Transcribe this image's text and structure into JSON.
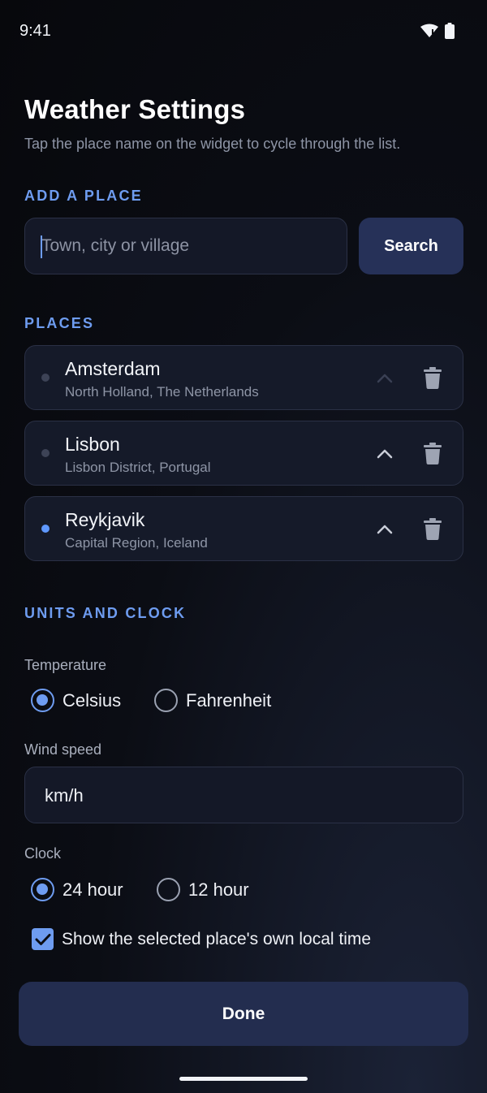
{
  "status_bar": {
    "time": "9:41",
    "icons": [
      "wifi-icon",
      "battery-icon"
    ]
  },
  "page": {
    "title": "Weather Settings",
    "subtitle": "Tap the place name on the widget to cycle through the list."
  },
  "add_place": {
    "section_label": "ADD A PLACE",
    "input_placeholder": "Town, city or village",
    "input_value": "",
    "search_label": "Search"
  },
  "places": {
    "section_label": "PLACES",
    "items": [
      {
        "name": "Amsterdam",
        "region": "North Holland, The Netherlands",
        "selected": false,
        "move_up_enabled": false
      },
      {
        "name": "Lisbon",
        "region": "Lisbon District, Portugal",
        "selected": false,
        "move_up_enabled": true
      },
      {
        "name": "Reykjavik",
        "region": "Capital Region, Iceland",
        "selected": true,
        "move_up_enabled": true
      }
    ]
  },
  "units": {
    "section_label": "UNITS AND CLOCK",
    "temperature": {
      "label": "Temperature",
      "options": [
        "Celsius",
        "Fahrenheit"
      ],
      "selected": "Celsius"
    },
    "wind": {
      "label": "Wind speed",
      "value": "km/h"
    },
    "clock": {
      "label": "Clock",
      "options": [
        "24 hour",
        "12 hour"
      ],
      "selected": "24 hour"
    },
    "local_time": {
      "label": "Show the selected place's own local time",
      "checked": true
    }
  },
  "done_label": "Done",
  "colors": {
    "accent": "#6e9cf0",
    "background": "#0b0d14",
    "card": "#151a29",
    "button": "#263158",
    "selected_dot": "#5f98ff"
  }
}
